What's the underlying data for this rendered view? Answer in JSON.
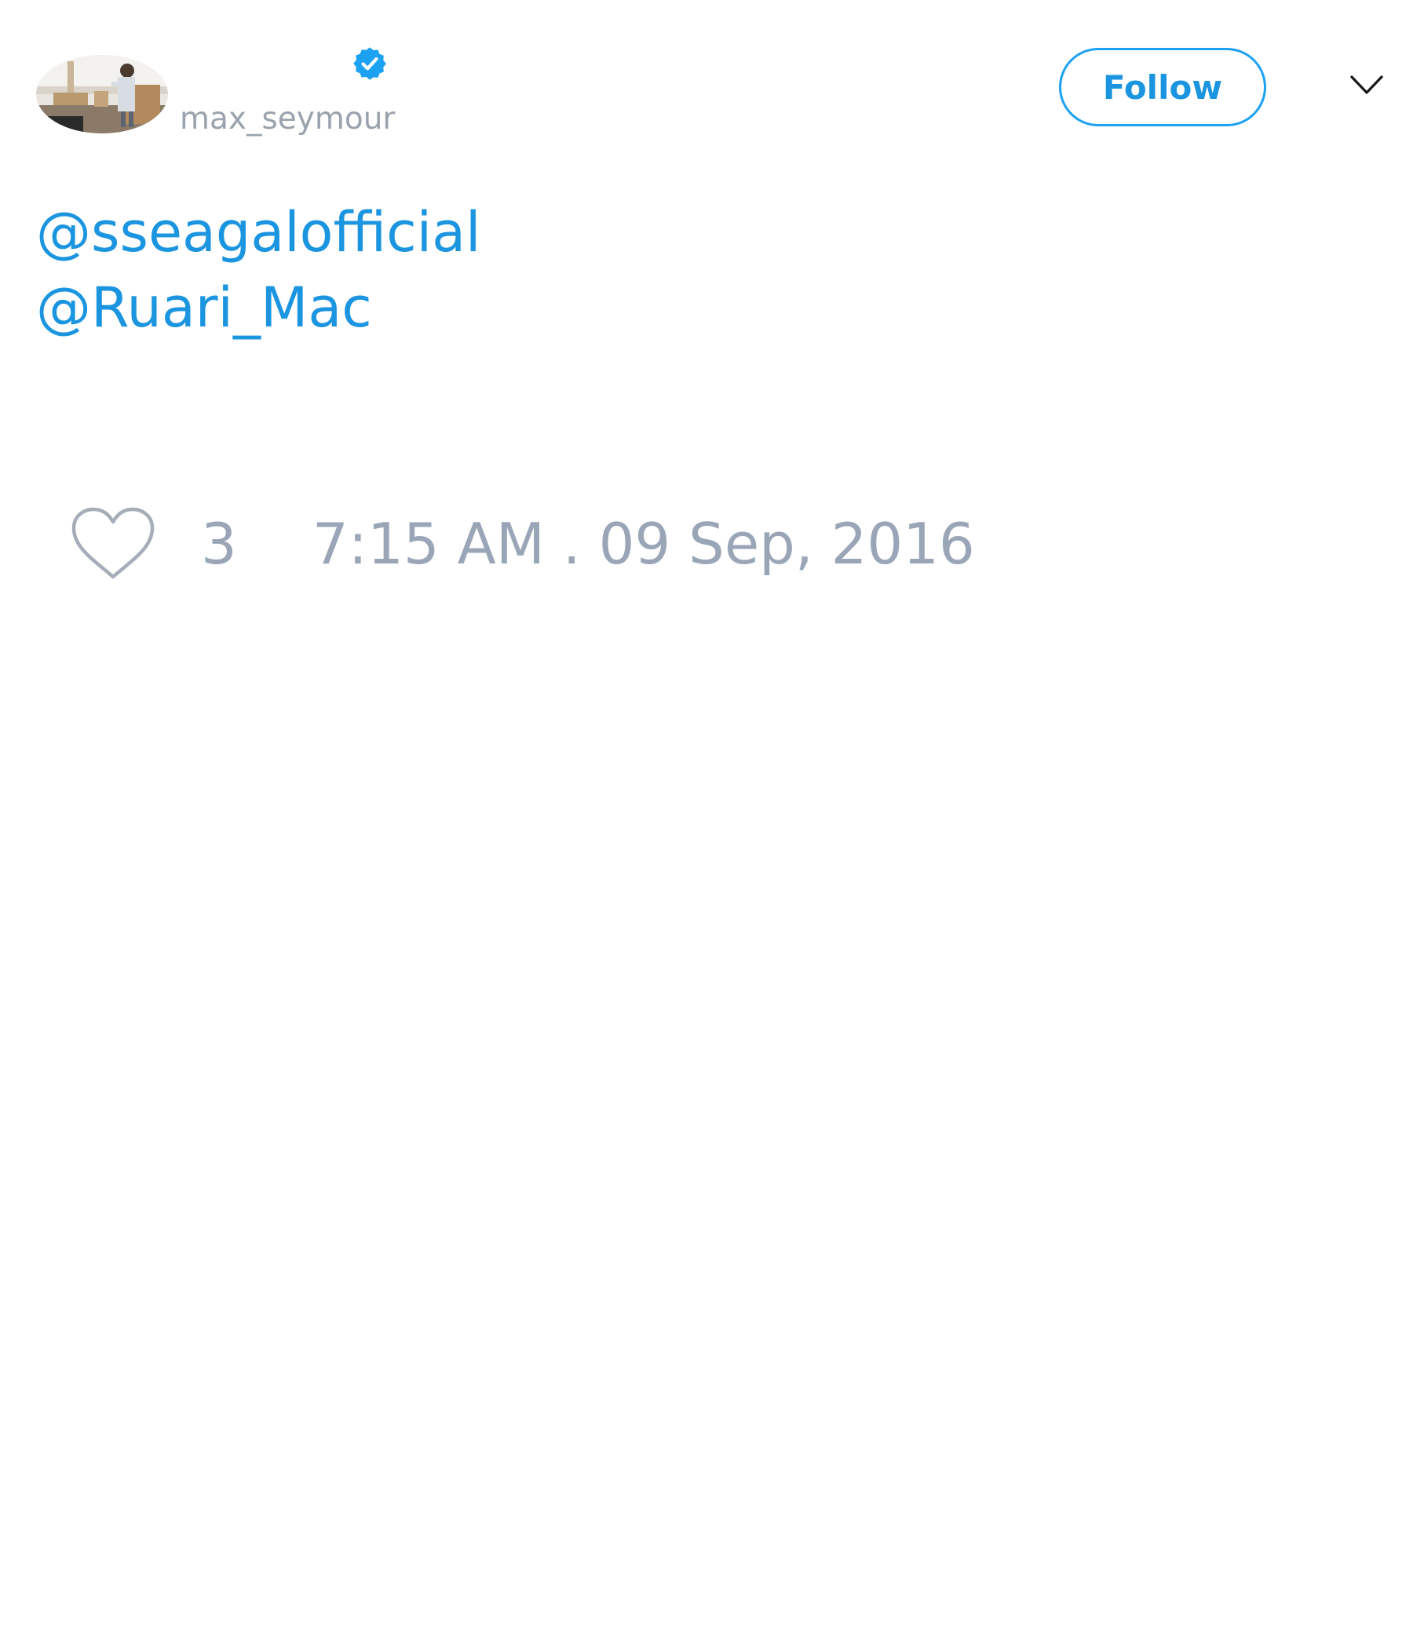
{
  "header": {
    "display_name": "",
    "handle": "max_seymour",
    "avatar_icon": "profile-photo",
    "verified_icon": "verified-badge-icon",
    "follow_label": "Follow",
    "menu_icon": "chevron-down-icon"
  },
  "tweet": {
    "mentions": [
      "@sseagalofficial",
      "@Ruari_Mac"
    ]
  },
  "footer": {
    "like_icon": "heart-icon",
    "like_count": "3",
    "timestamp": "7:15 AM . 09 Sep, 2016"
  },
  "colors": {
    "accent": "#1da1f2",
    "link": "#1b95e0",
    "muted": "#9aa6b7",
    "background": "#ffffff"
  }
}
